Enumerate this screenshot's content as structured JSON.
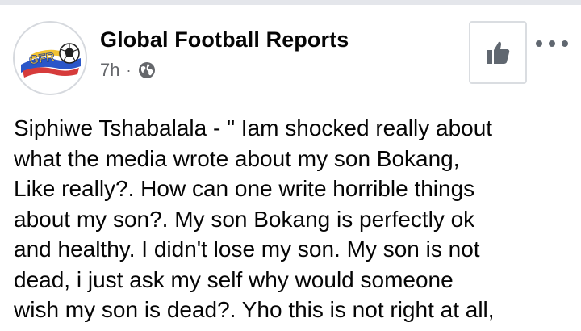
{
  "post": {
    "page_name": "Global Football Reports",
    "avatar_logo_text": "GFR",
    "time": "7h",
    "separator": "·",
    "privacy_icon": "globe-icon",
    "like_icon": "thumbs-up-icon",
    "more_icon": "more-options-icon",
    "text_lines": [
      "Siphiwe Tshabalala - \" Iam shocked really about",
      "what the media wrote about my son Bokang,",
      "Like really?. How can one write horrible things",
      "about my son?. My son Bokang is perfectly ok",
      "and healthy. I didn't  lose my son. My son is not",
      "dead, i just ask my self why would someone",
      "wish my son is dead?. Yho this is not right at all,"
    ]
  },
  "colors": {
    "name": "#050505",
    "meta": "#65676b",
    "icon": "#606770",
    "divider": "#e4e6eb"
  }
}
